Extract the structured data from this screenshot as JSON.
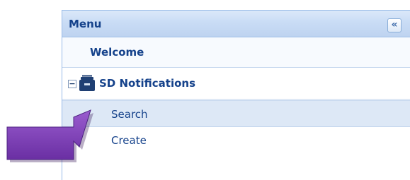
{
  "menu": {
    "title": "Menu",
    "collapse_glyph": "«",
    "collapse_icon": "double-chevron-left-icon"
  },
  "items": {
    "welcome": "Welcome",
    "section": {
      "label": "SD Notifications",
      "toggle_glyph": "−",
      "toggle_state": "expanded",
      "icon": "folder-icon"
    },
    "search": "Search",
    "create": "Create"
  },
  "annotation": {
    "icon": "pointer-arrow-icon",
    "color": "#7b3fb4"
  },
  "colors": {
    "header_text": "#15428b",
    "header_bg": "#c9dcf5",
    "border": "#99bbe8",
    "selected_row_bg": "#dde8f6"
  }
}
